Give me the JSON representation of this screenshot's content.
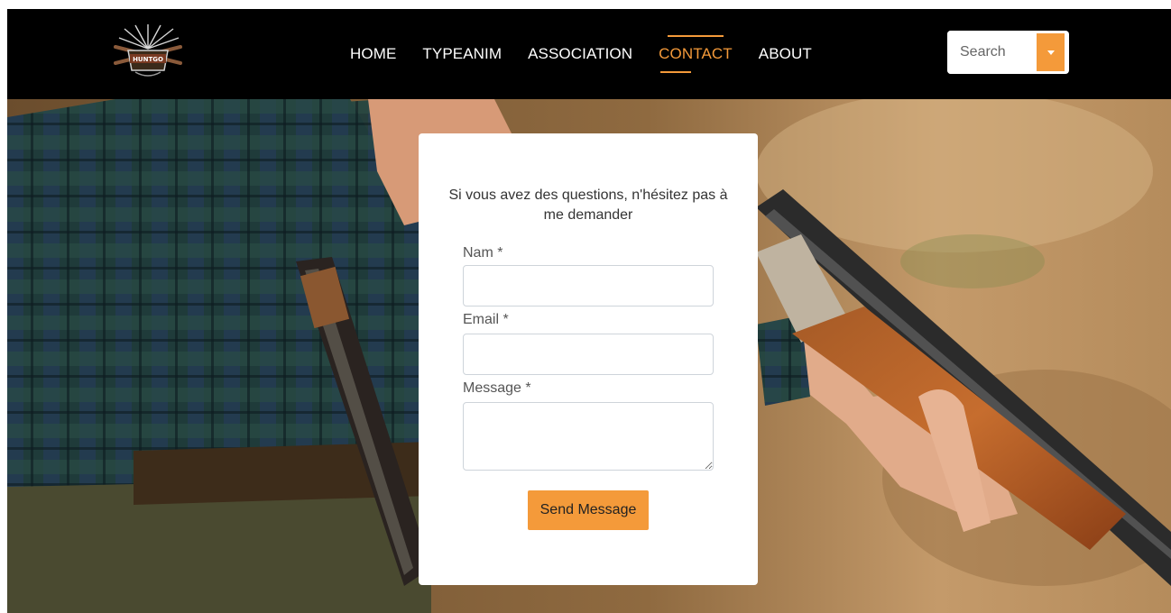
{
  "brand": {
    "logo_name": "HUNTGO"
  },
  "nav": {
    "items": [
      {
        "label": "HOME"
      },
      {
        "label": "TYPEANIM"
      },
      {
        "label": "ASSOCIATION"
      },
      {
        "label": "CONTACT",
        "active": true
      },
      {
        "label": "ABOUT"
      }
    ]
  },
  "search": {
    "placeholder": "Search"
  },
  "contact_form": {
    "heading": "Si vous avez des questions, n'hésitez pas à me demander",
    "fields": [
      {
        "label": "Nam *"
      },
      {
        "label": "Email *"
      },
      {
        "label": "Message *"
      }
    ],
    "submit_label": "Send Message"
  },
  "colors": {
    "accent": "#f49a3a",
    "navbar_bg": "#000000",
    "card_bg": "#ffffff"
  }
}
